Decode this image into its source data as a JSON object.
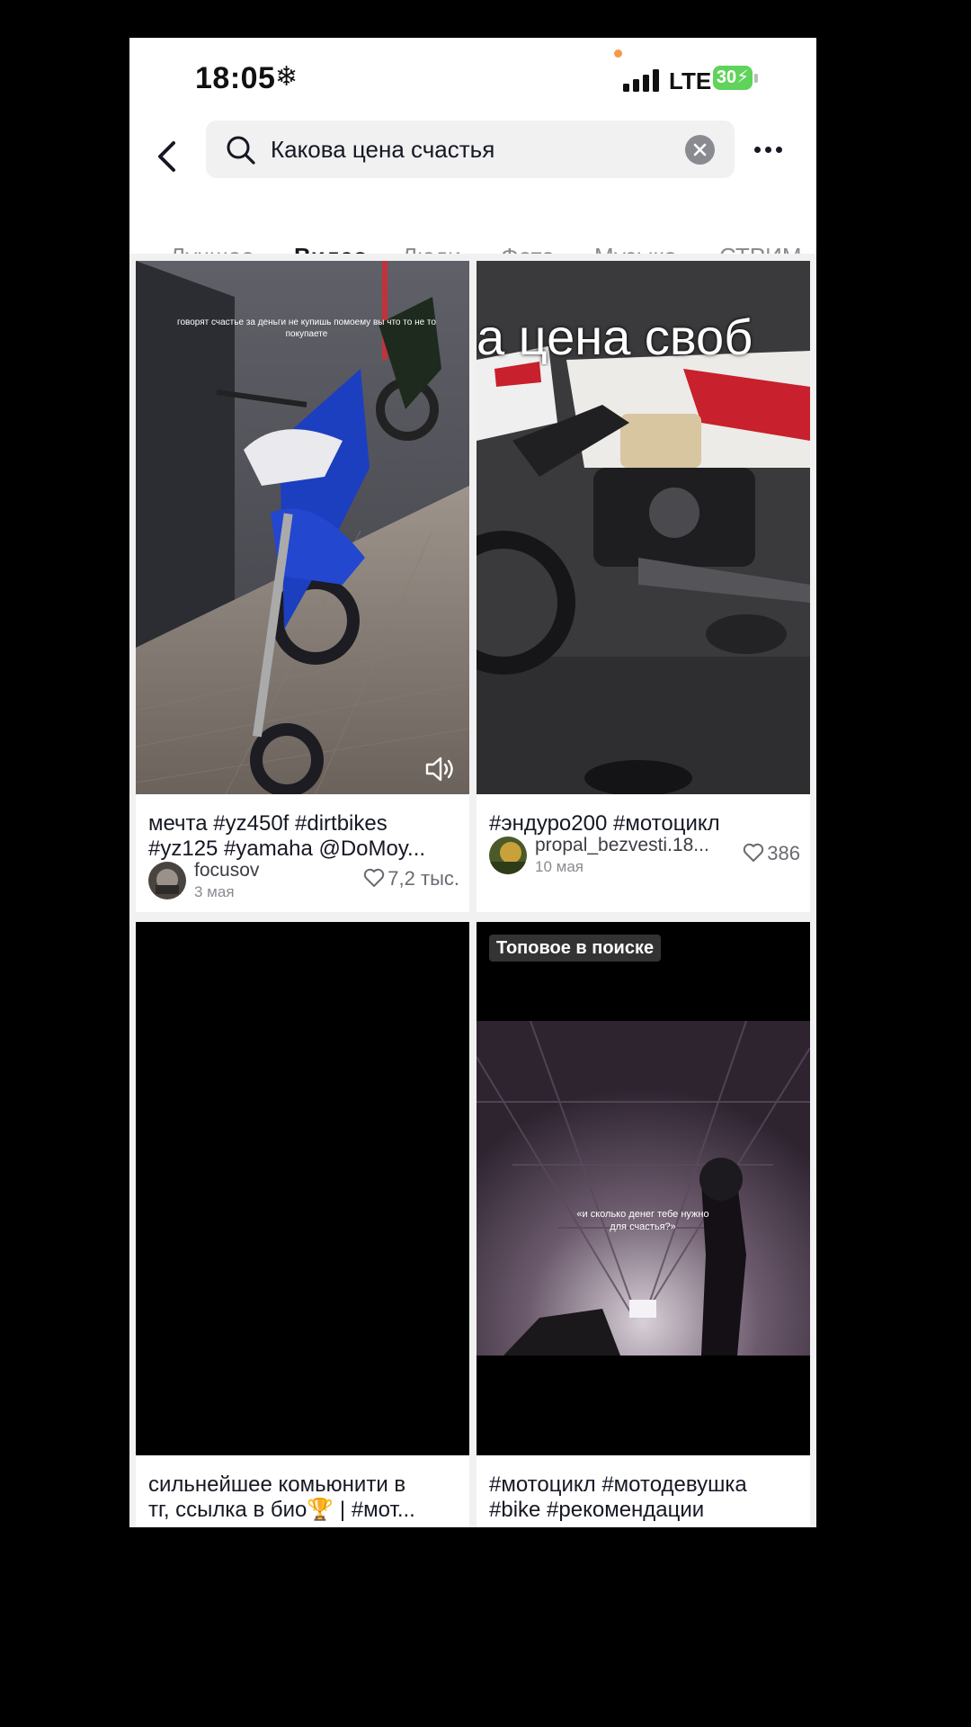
{
  "status_bar": {
    "time": "18:05",
    "network": "LTE",
    "battery": "30"
  },
  "search": {
    "query": "Какова цена счастья"
  },
  "tabs": [
    {
      "label": "Лучшее"
    },
    {
      "label": "Видео"
    },
    {
      "label": "Люди"
    },
    {
      "label": "Фото"
    },
    {
      "label": "Музыка"
    },
    {
      "label": "СТРИМ"
    }
  ],
  "active_tab": "Видео",
  "videos": [
    {
      "overlay_text": "говорят счастье за деньги не купишь помоему вы что то не то покупаете",
      "caption_lines": [
        "мечта #yz450f #dirtbikes",
        "#yz125 #yamaha @DoMoy..."
      ],
      "author": "focusov",
      "date": "3 мая",
      "likes": "7,2 тыс."
    },
    {
      "overlay_text": "а цена своб",
      "caption_lines": [
        "#эндуро200 #мотоцикл"
      ],
      "author": "propal_bezvesti.18...",
      "date": "10 мая",
      "likes": "386"
    },
    {
      "caption_lines": [
        "сильнейшее комьюнити в",
        "тг, ссылка в био🏆 | #мот..."
      ]
    },
    {
      "badge": "Топовое в поиске",
      "overlay_text": "«и сколько денег тебе нужно для счастья?»",
      "caption_lines": [
        "#мотоцикл #мотодевушка",
        "#bike #рекомендации"
      ]
    }
  ],
  "colors": {
    "accent_text": "#161823",
    "secondary_text": "#8a8b91",
    "battery": "#5fd35a"
  }
}
